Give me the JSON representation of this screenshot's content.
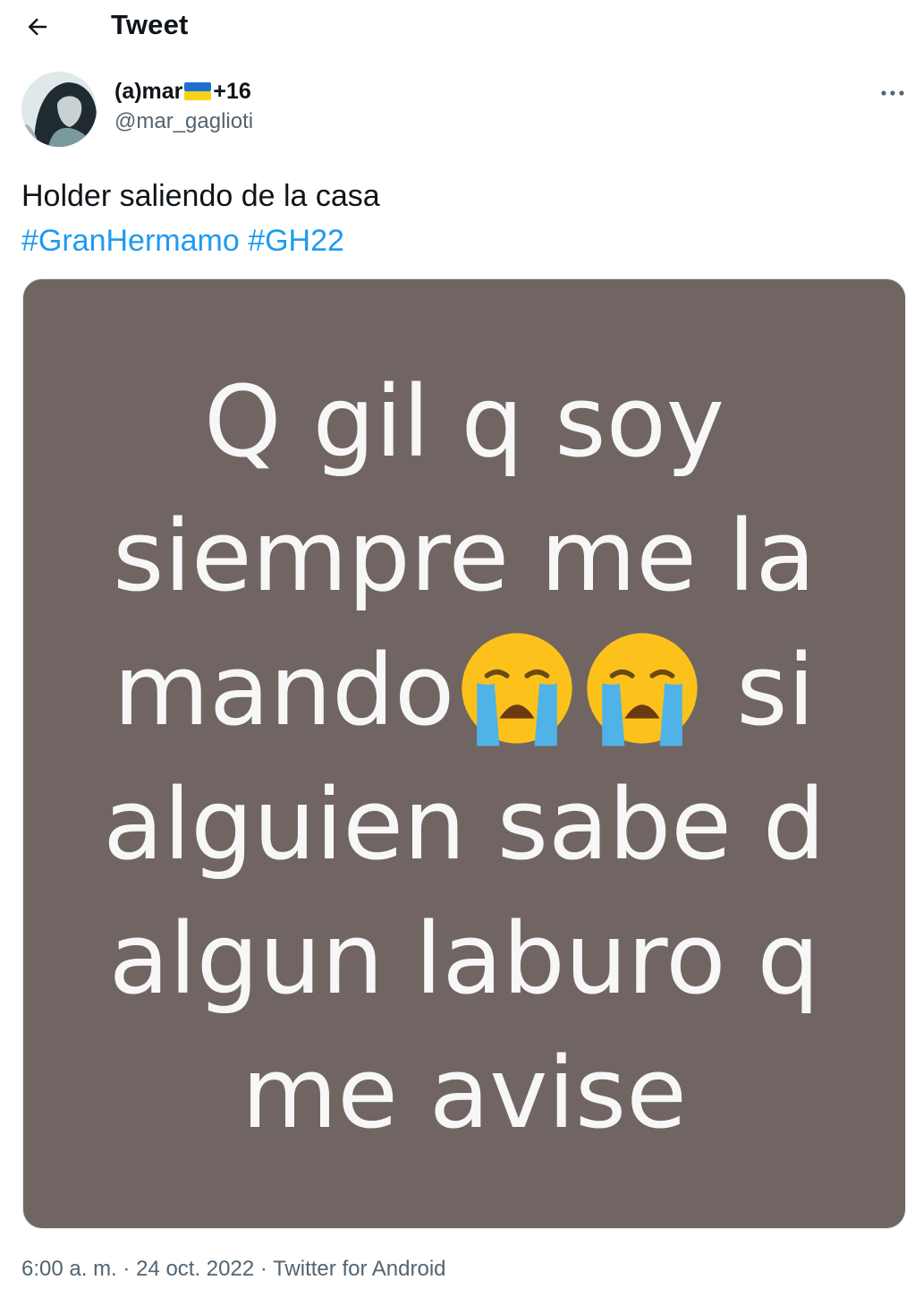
{
  "header": {
    "title": "Tweet"
  },
  "author": {
    "display_name": "(a)mar",
    "name_suffix": "+16",
    "handle": "@mar_gaglioti"
  },
  "tweet": {
    "text": "Holder saliendo de la casa",
    "hashtags": [
      "#GranHermamo",
      "#GH22"
    ]
  },
  "media": {
    "lines": [
      "Q gil q soy",
      "siempre me la",
      "mando",
      "si",
      "alguien sabe d",
      "algun laburo q",
      "me avise"
    ],
    "background": "#716563",
    "emoji": "crying-face"
  },
  "meta": {
    "time": "6:00 a. m.",
    "separator": "·",
    "date": "24 oct. 2022",
    "source": "Twitter for Android"
  },
  "colors": {
    "link": "#1d9bf0",
    "secondary": "#536471",
    "text": "#0f1419"
  }
}
